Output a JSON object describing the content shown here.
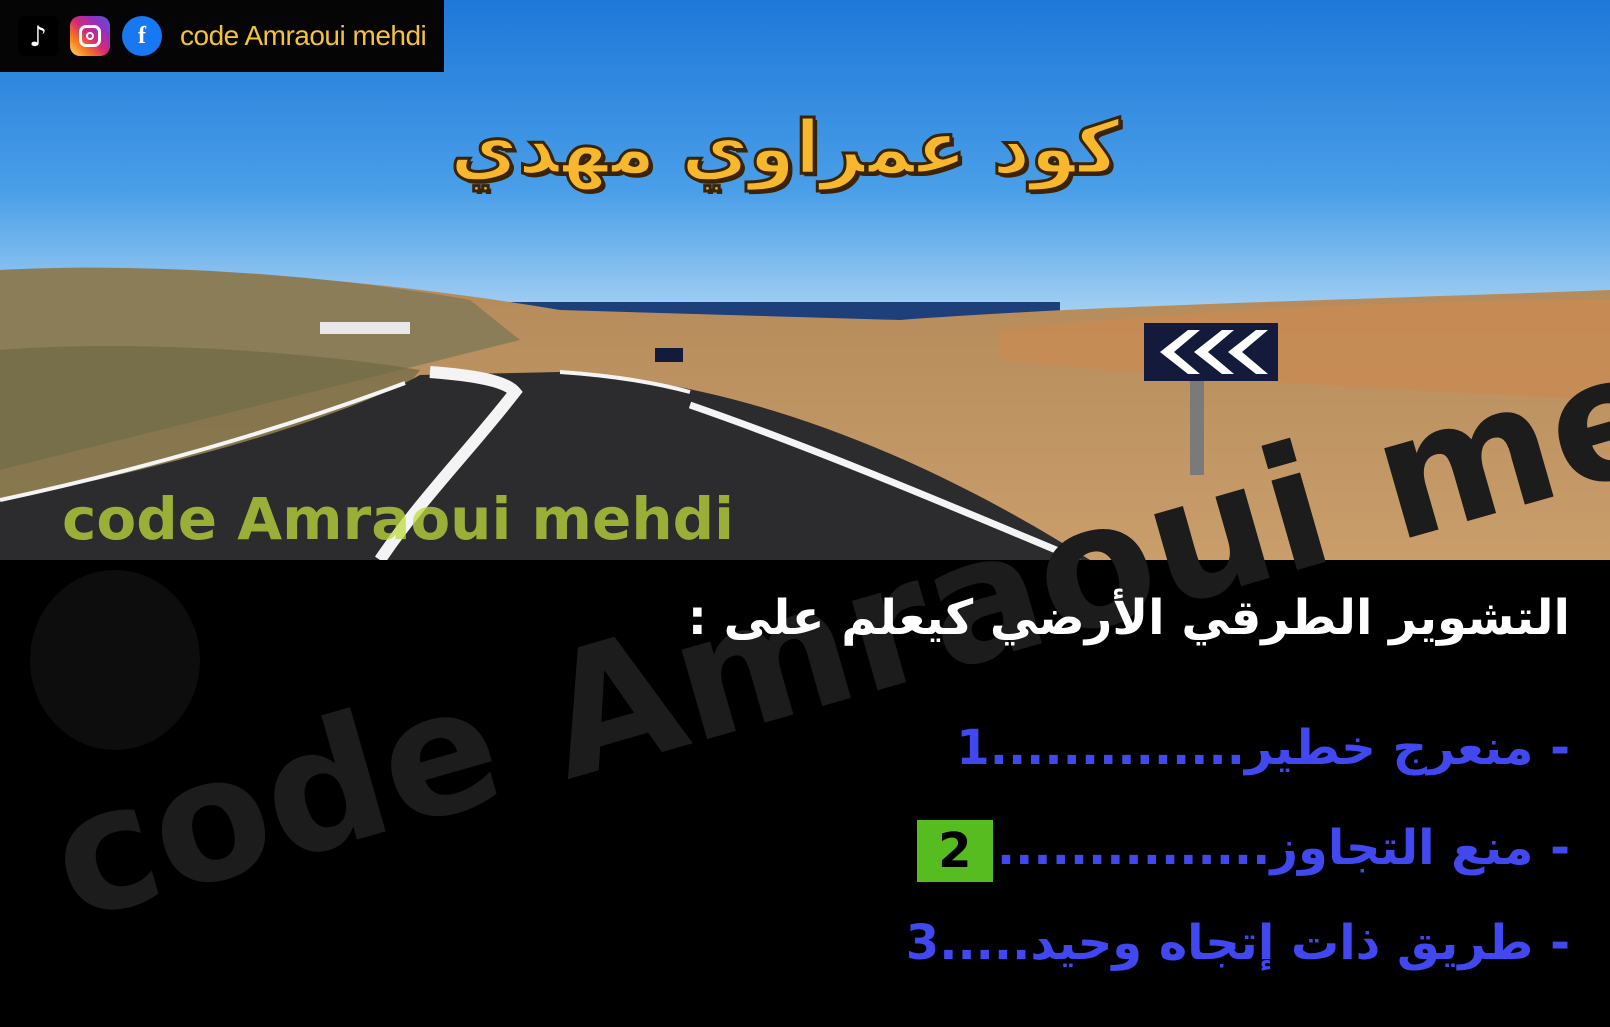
{
  "social": {
    "handle": "code Amraoui mehdi",
    "tiktok_label": "TikTok",
    "icons": [
      "tiktok-icon",
      "instagram-icon",
      "facebook-icon"
    ]
  },
  "title": "كود عمراوي مهدي",
  "scene_watermark": "code Amraoui mehdi",
  "big_watermark": "code Amraoui mehdi",
  "question": "التشوير الطرقي الأرضي كيعلم على :",
  "answers": [
    {
      "text": "- منعرج خطير",
      "dots": "..............",
      "number": "1"
    },
    {
      "text": "- منع التجاوز",
      "dots": "...............",
      "number": "2"
    },
    {
      "text": "- طريق ذات إتجاه وحيد",
      "dots": ".....",
      "number": "3"
    }
  ],
  "colors": {
    "title": "#f7b82d",
    "answer_text": "#4148f0",
    "badge": "#57bc1f",
    "question": "#ffffff"
  }
}
